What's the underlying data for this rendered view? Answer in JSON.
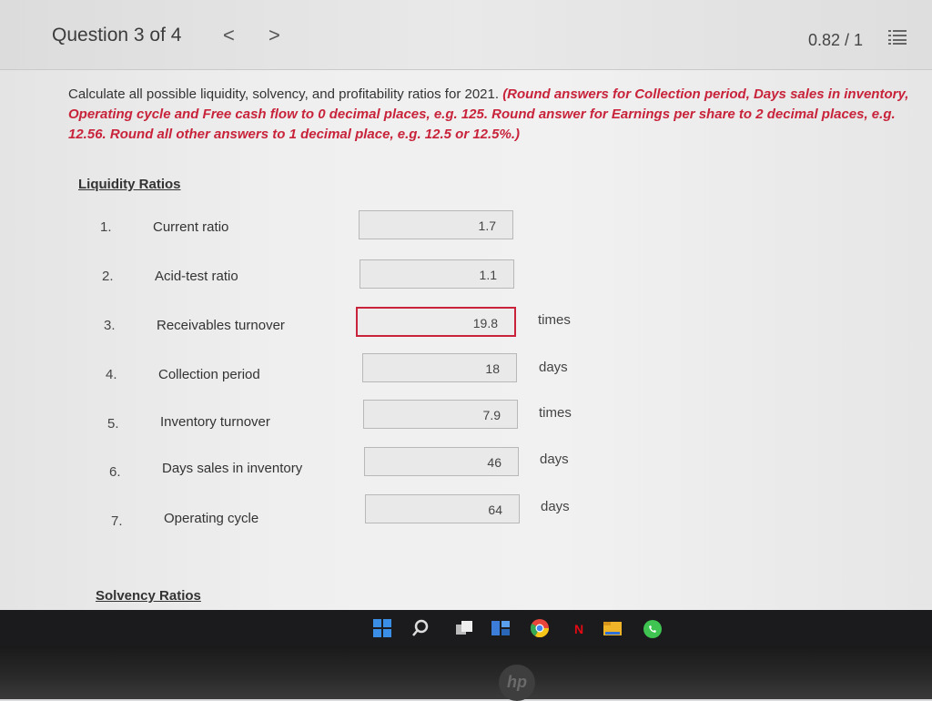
{
  "header": {
    "question_label": "Question 3 of 4",
    "prev_arrow": "<",
    "next_arrow": ">",
    "score": "0.82 / 1"
  },
  "instructions": {
    "plain": "Calculate all possible liquidity, solvency, and profitability ratios for 2021. ",
    "red": "(Round answers for Collection period, Days sales in inventory, Operating cycle and Free cash flow to 0 decimal places, e.g. 125. Round answer for Earnings per share to 2 decimal places, e.g. 12.56. Round all other answers to 1 decimal place, e.g. 12.5 or 12.5%.)"
  },
  "liquidity": {
    "heading": "Liquidity Ratios",
    "rows": [
      {
        "num": "1.",
        "label": "Current ratio",
        "value": "1.7",
        "unit": ""
      },
      {
        "num": "2.",
        "label": "Acid-test ratio",
        "value": "1.1",
        "unit": ""
      },
      {
        "num": "3.",
        "label": "Receivables turnover",
        "value": "19.8",
        "unit": "times"
      },
      {
        "num": "4.",
        "label": "Collection period",
        "value": "18",
        "unit": "days"
      },
      {
        "num": "5.",
        "label": "Inventory turnover",
        "value": "7.9",
        "unit": "times"
      },
      {
        "num": "6.",
        "label": "Days sales in inventory",
        "value": "46",
        "unit": "days"
      },
      {
        "num": "7.",
        "label": "Operating cycle",
        "value": "64",
        "unit": "days"
      }
    ]
  },
  "solvency": {
    "heading": "Solvency Ratios"
  },
  "taskbar": {
    "icons": [
      "windows-start-icon",
      "search-icon",
      "task-view-icon",
      "widgets-icon",
      "chrome-icon",
      "netflix-icon",
      "file-explorer-icon",
      "whatsapp-icon"
    ]
  },
  "colors": {
    "accent_red": "#c8233a",
    "screen_bg": "#efefef",
    "taskbar_bg": "#1b1b1d"
  }
}
